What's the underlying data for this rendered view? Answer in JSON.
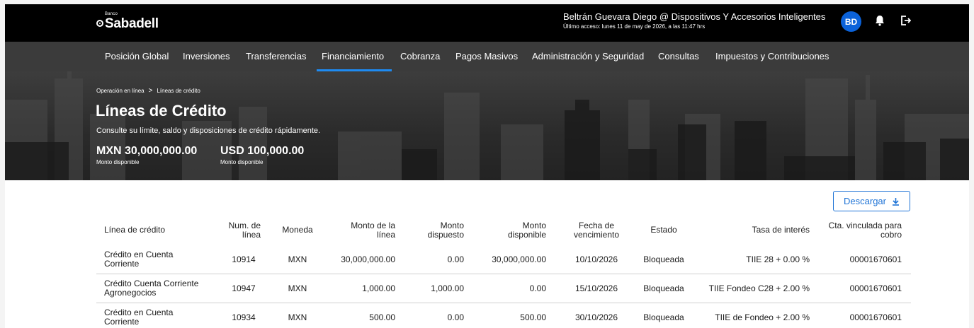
{
  "header": {
    "logo_small": "Banco",
    "logo_name": "Sabadell",
    "user_name": "Beltrán Guevara Diego @ Dispositivos Y Accesorios Inteligentes",
    "last_access": "Último acceso: lunes 11 de may de 2026, a las 11:47 hrs",
    "avatar_initials": "BD",
    "icons": [
      "bell-icon",
      "logout-icon"
    ]
  },
  "nav": {
    "items": [
      "Posición Global",
      "Inversiones",
      "Transferencias",
      "Financiamiento",
      "Cobranza",
      "Pagos Masivos",
      "Administración y Seguridad",
      "Consultas",
      "Impuestos y Contribuciones"
    ],
    "active": "Financiamiento",
    "active_color": "#1e8bf2"
  },
  "hero": {
    "breadcrumb": [
      "Operación en línea",
      "Líneas de crédito"
    ],
    "breadcrumb_separator": ">",
    "title": "Líneas de Crédito",
    "subtitle": "Consulte su límite, saldo y disposiciones de crédito rápidamente.",
    "amounts": [
      {
        "value": "MXN 30,000,000.00",
        "label": "Monto disponible"
      },
      {
        "value": "USD 100,000.00",
        "label": "Monto disponible"
      }
    ]
  },
  "actions": {
    "download_label": "Descargar",
    "accent": "#1e73d6"
  },
  "table": {
    "headers": [
      "Línea de crédito",
      "Num. de línea",
      "Moneda",
      "Monto de la línea",
      "Monto dispuesto",
      "Monto disponible",
      "Fecha de vencimiento",
      "Estado",
      "Tasa de interés",
      "Cta. vinculada para cobro"
    ],
    "rows": [
      [
        "Crédito en Cuenta Corriente",
        "10914",
        "MXN",
        "30,000,000.00",
        "0.00",
        "30,000,000.00",
        "10/10/2026",
        "Bloqueada",
        "TIIE 28 + 0.00 %",
        "00001670601"
      ],
      [
        "Crédito Cuenta Corriente Agronegocios",
        "10947",
        "MXN",
        "1,000.00",
        "1,000.00",
        "0.00",
        "15/10/2026",
        "Bloqueada",
        "TIIE Fondeo C28 + 2.00 %",
        "00001670601"
      ],
      [
        "Crédito en Cuenta Corriente",
        "10934",
        "MXN",
        "500.00",
        "0.00",
        "500.00",
        "30/10/2026",
        "Bloqueada",
        "TIIE de Fondeo + 2.00 %",
        "00001670601"
      ]
    ]
  }
}
